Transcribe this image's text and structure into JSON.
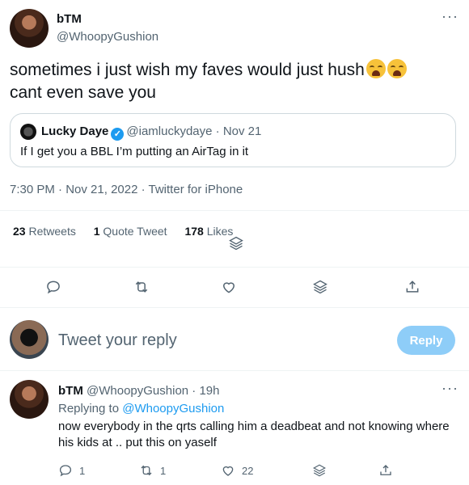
{
  "tweet": {
    "display_name": "bTM",
    "handle": "@WhoopyGushion",
    "more_icon": "more-horizontal-icon",
    "text_line1": "sometimes i just wish my faves would just hush",
    "text_line2": "cant even save you",
    "emoji": "loudly-crying-face",
    "quote": {
      "display_name": "Lucky Daye",
      "handle": "@iamluckydaye",
      "separator": "·",
      "date": "Nov 21",
      "text": "If I get you a BBL I’m putting an AirTag in it"
    },
    "time": "7:30 PM",
    "date": "Nov 21, 2022",
    "client": "Twitter for iPhone",
    "stats": {
      "retweets_count": "23",
      "retweets_label": "Retweets",
      "quote_count": "1",
      "quote_label": "Quote Tweet",
      "likes_count": "178",
      "likes_label": "Likes"
    }
  },
  "compose": {
    "placeholder": "Tweet your reply",
    "button_label": "Reply"
  },
  "reply": {
    "display_name": "bTM",
    "handle": "@WhoopyGushion",
    "age": "19h",
    "replying_prefix": "Replying to",
    "replying_to": "@WhoopyGushion",
    "text": "now everybody in the qrts calling him a deadbeat and not knowing where his kids at .. put this on yaself",
    "reply_count": "1",
    "retweet_count": "1",
    "like_count": "22"
  },
  "colors": {
    "accent": "#1d9bf0",
    "muted": "#536471",
    "reply_button_disabled": "#8ecdf8"
  }
}
